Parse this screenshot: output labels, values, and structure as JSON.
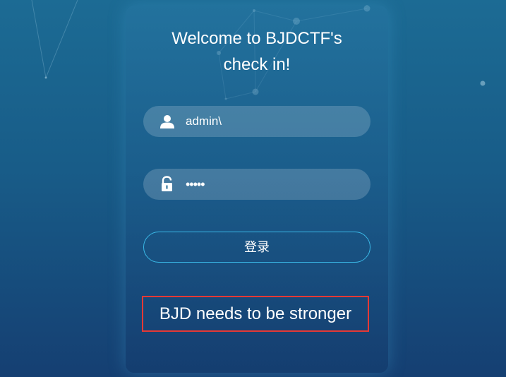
{
  "login": {
    "title_line1": "Welcome to BJDCTF's",
    "title_line2": "check in!",
    "username_value": "admin\\",
    "password_value": "•••••",
    "submit_label": "登录",
    "message": "BJD needs to be stronger"
  },
  "icons": {
    "username": "user-icon",
    "password": "lock-icon"
  },
  "colors": {
    "background_top": "#1c6b94",
    "background_bottom": "#153f72",
    "button_border": "#3ab8e6",
    "message_border": "#e53935"
  }
}
